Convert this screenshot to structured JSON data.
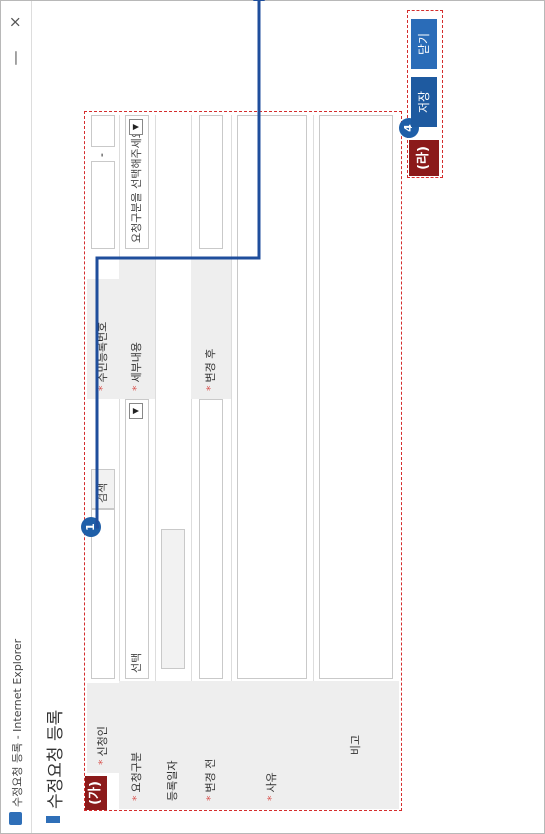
{
  "window": {
    "title": "수정요청 등록 - Internet Explorer",
    "minimize": "—",
    "close": "×"
  },
  "page": {
    "title": "수정요청 등록"
  },
  "annotations": {
    "region_ga": "(가)",
    "region_ra": "(라)",
    "marker_1": "1",
    "marker_4": "4"
  },
  "form": {
    "applicant_label": "신청인",
    "search_button": "검색",
    "resident_label": "주민등록번호",
    "resident_sep": "-",
    "req_type_label": "요청구분",
    "req_type_value": "선택",
    "detail_label": "세부내용",
    "detail_value": "요청구분을 선택해주세요.",
    "reg_date_label": "등록일자",
    "before_label": "변경 전",
    "after_label": "변경 후",
    "reason_label": "사유",
    "remark_label": "비고"
  },
  "buttons": {
    "save": "저장",
    "close": "닫기"
  },
  "colors": {
    "accent": "#1e5aa0",
    "annotation": "#8b1a1a",
    "dash": "#d42d2d",
    "arrow": "#1f4e9c"
  }
}
